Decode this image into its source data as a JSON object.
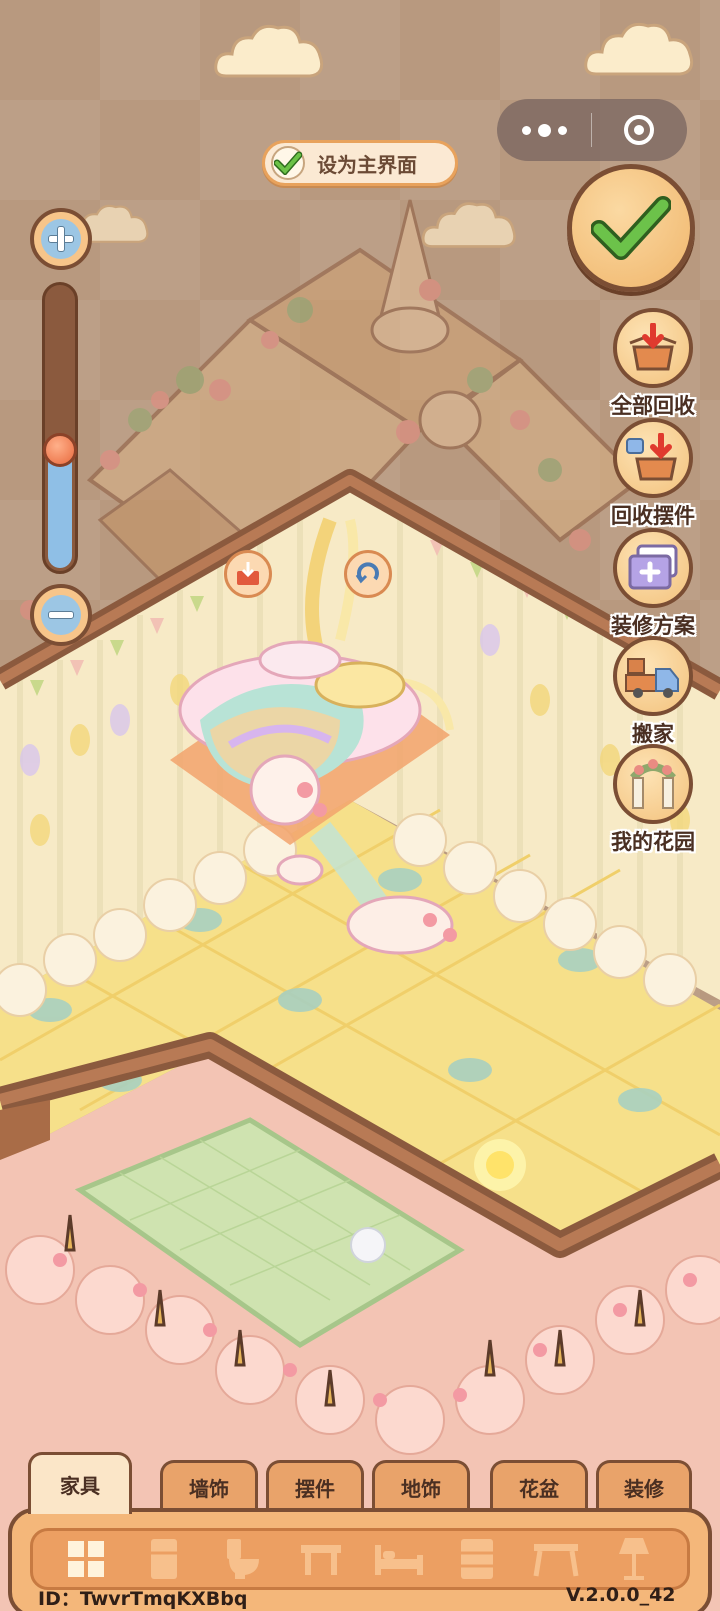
{
  "top_capsule": {
    "menu_icon": "more-dots-icon",
    "close_icon": "target-circle-icon"
  },
  "set_home": {
    "label": "设为主界面",
    "checked": true
  },
  "zoom": {
    "level": 0.42,
    "plus_icon": "zoom-in-icon",
    "minus_icon": "zoom-out-icon"
  },
  "side_menu": [
    {
      "label": "全部回收",
      "icon": "recycle-all-icon"
    },
    {
      "label": "回收摆件",
      "icon": "recycle-item-icon"
    },
    {
      "label": "装修方案",
      "icon": "decoration-plan-icon"
    },
    {
      "label": "搬家",
      "icon": "moving-truck-icon"
    },
    {
      "label": "我的花园",
      "icon": "garden-arch-icon"
    }
  ],
  "tabs": [
    {
      "label": "家具",
      "active": true
    },
    {
      "label": "墙饰",
      "active": false
    },
    {
      "label": "摆件",
      "active": false
    },
    {
      "label": "地饰",
      "active": false
    },
    {
      "label": "花盆",
      "active": false
    },
    {
      "label": "装修",
      "active": false
    }
  ],
  "categories": [
    "all-grid-icon",
    "fridge-icon",
    "toilet-icon",
    "table-icon",
    "bed-icon",
    "cabinet-icon",
    "desk-icon",
    "lamp-icon"
  ],
  "footer": {
    "id_text": "ID：TwvrTmqKXBbq",
    "version": "V.2.0.0_42"
  },
  "colors": {
    "brown_border": "#7b4e34",
    "tab_orange": "#e9a36a",
    "tab_active": "#fbe6c8",
    "check_green": "#5cb85c"
  }
}
